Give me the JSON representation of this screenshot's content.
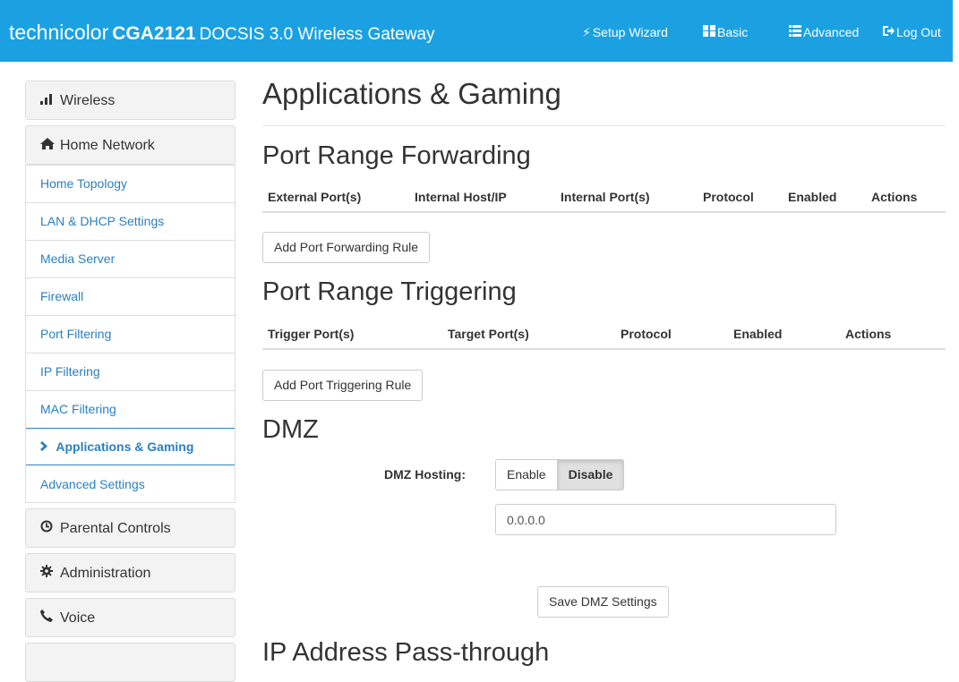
{
  "header": {
    "brand_name": "technicolor",
    "model": "CGA2121",
    "product": "DOCSIS 3.0 Wireless Gateway",
    "nav": [
      {
        "label": "Setup Wizard",
        "icon": "bolt-icon"
      },
      {
        "label": "Basic",
        "icon": "grid-icon"
      },
      {
        "label": "Advanced",
        "icon": "list-icon"
      },
      {
        "label": "Log Out",
        "icon": "logout-icon"
      }
    ],
    "bg_color": "#1ba1e2"
  },
  "sidebar": {
    "groups_top": [
      {
        "label": "Wireless",
        "icon": "signal-bars-icon"
      },
      {
        "label": "Home Network",
        "icon": "home-icon"
      }
    ],
    "sub_items": [
      {
        "label": "Home Topology"
      },
      {
        "label": "LAN & DHCP Settings"
      },
      {
        "label": "Media Server"
      },
      {
        "label": "Firewall"
      },
      {
        "label": "Port Filtering"
      },
      {
        "label": "IP Filtering"
      },
      {
        "label": "MAC Filtering"
      },
      {
        "label": "Applications & Gaming",
        "active": true
      },
      {
        "label": "Advanced Settings"
      }
    ],
    "groups_bottom": [
      {
        "label": "Parental Controls",
        "icon": "clock-icon"
      },
      {
        "label": "Administration",
        "icon": "gear-icon"
      },
      {
        "label": "Voice",
        "icon": "phone-icon"
      }
    ],
    "link_color": "#2a80c1"
  },
  "main": {
    "title": "Applications & Gaming",
    "forwarding": {
      "title": "Port Range Forwarding",
      "columns": [
        "External Port(s)",
        "Internal Host/IP",
        "Internal Port(s)",
        "Protocol",
        "Enabled",
        "Actions"
      ],
      "add_button": "Add Port Forwarding Rule"
    },
    "triggering": {
      "title": "Port Range Triggering",
      "columns": [
        "Trigger Port(s)",
        "Target Port(s)",
        "Protocol",
        "Enabled",
        "Actions"
      ],
      "add_button": "Add Port Triggering Rule"
    },
    "dmz": {
      "title": "DMZ",
      "hosting_label": "DMZ Hosting:",
      "enable_label": "Enable",
      "disable_label": "Disable",
      "selected": "Disable",
      "ip_value": "0.0.0.0",
      "save_button": "Save DMZ Settings"
    },
    "next_section_title": "IP Address Pass-through"
  }
}
